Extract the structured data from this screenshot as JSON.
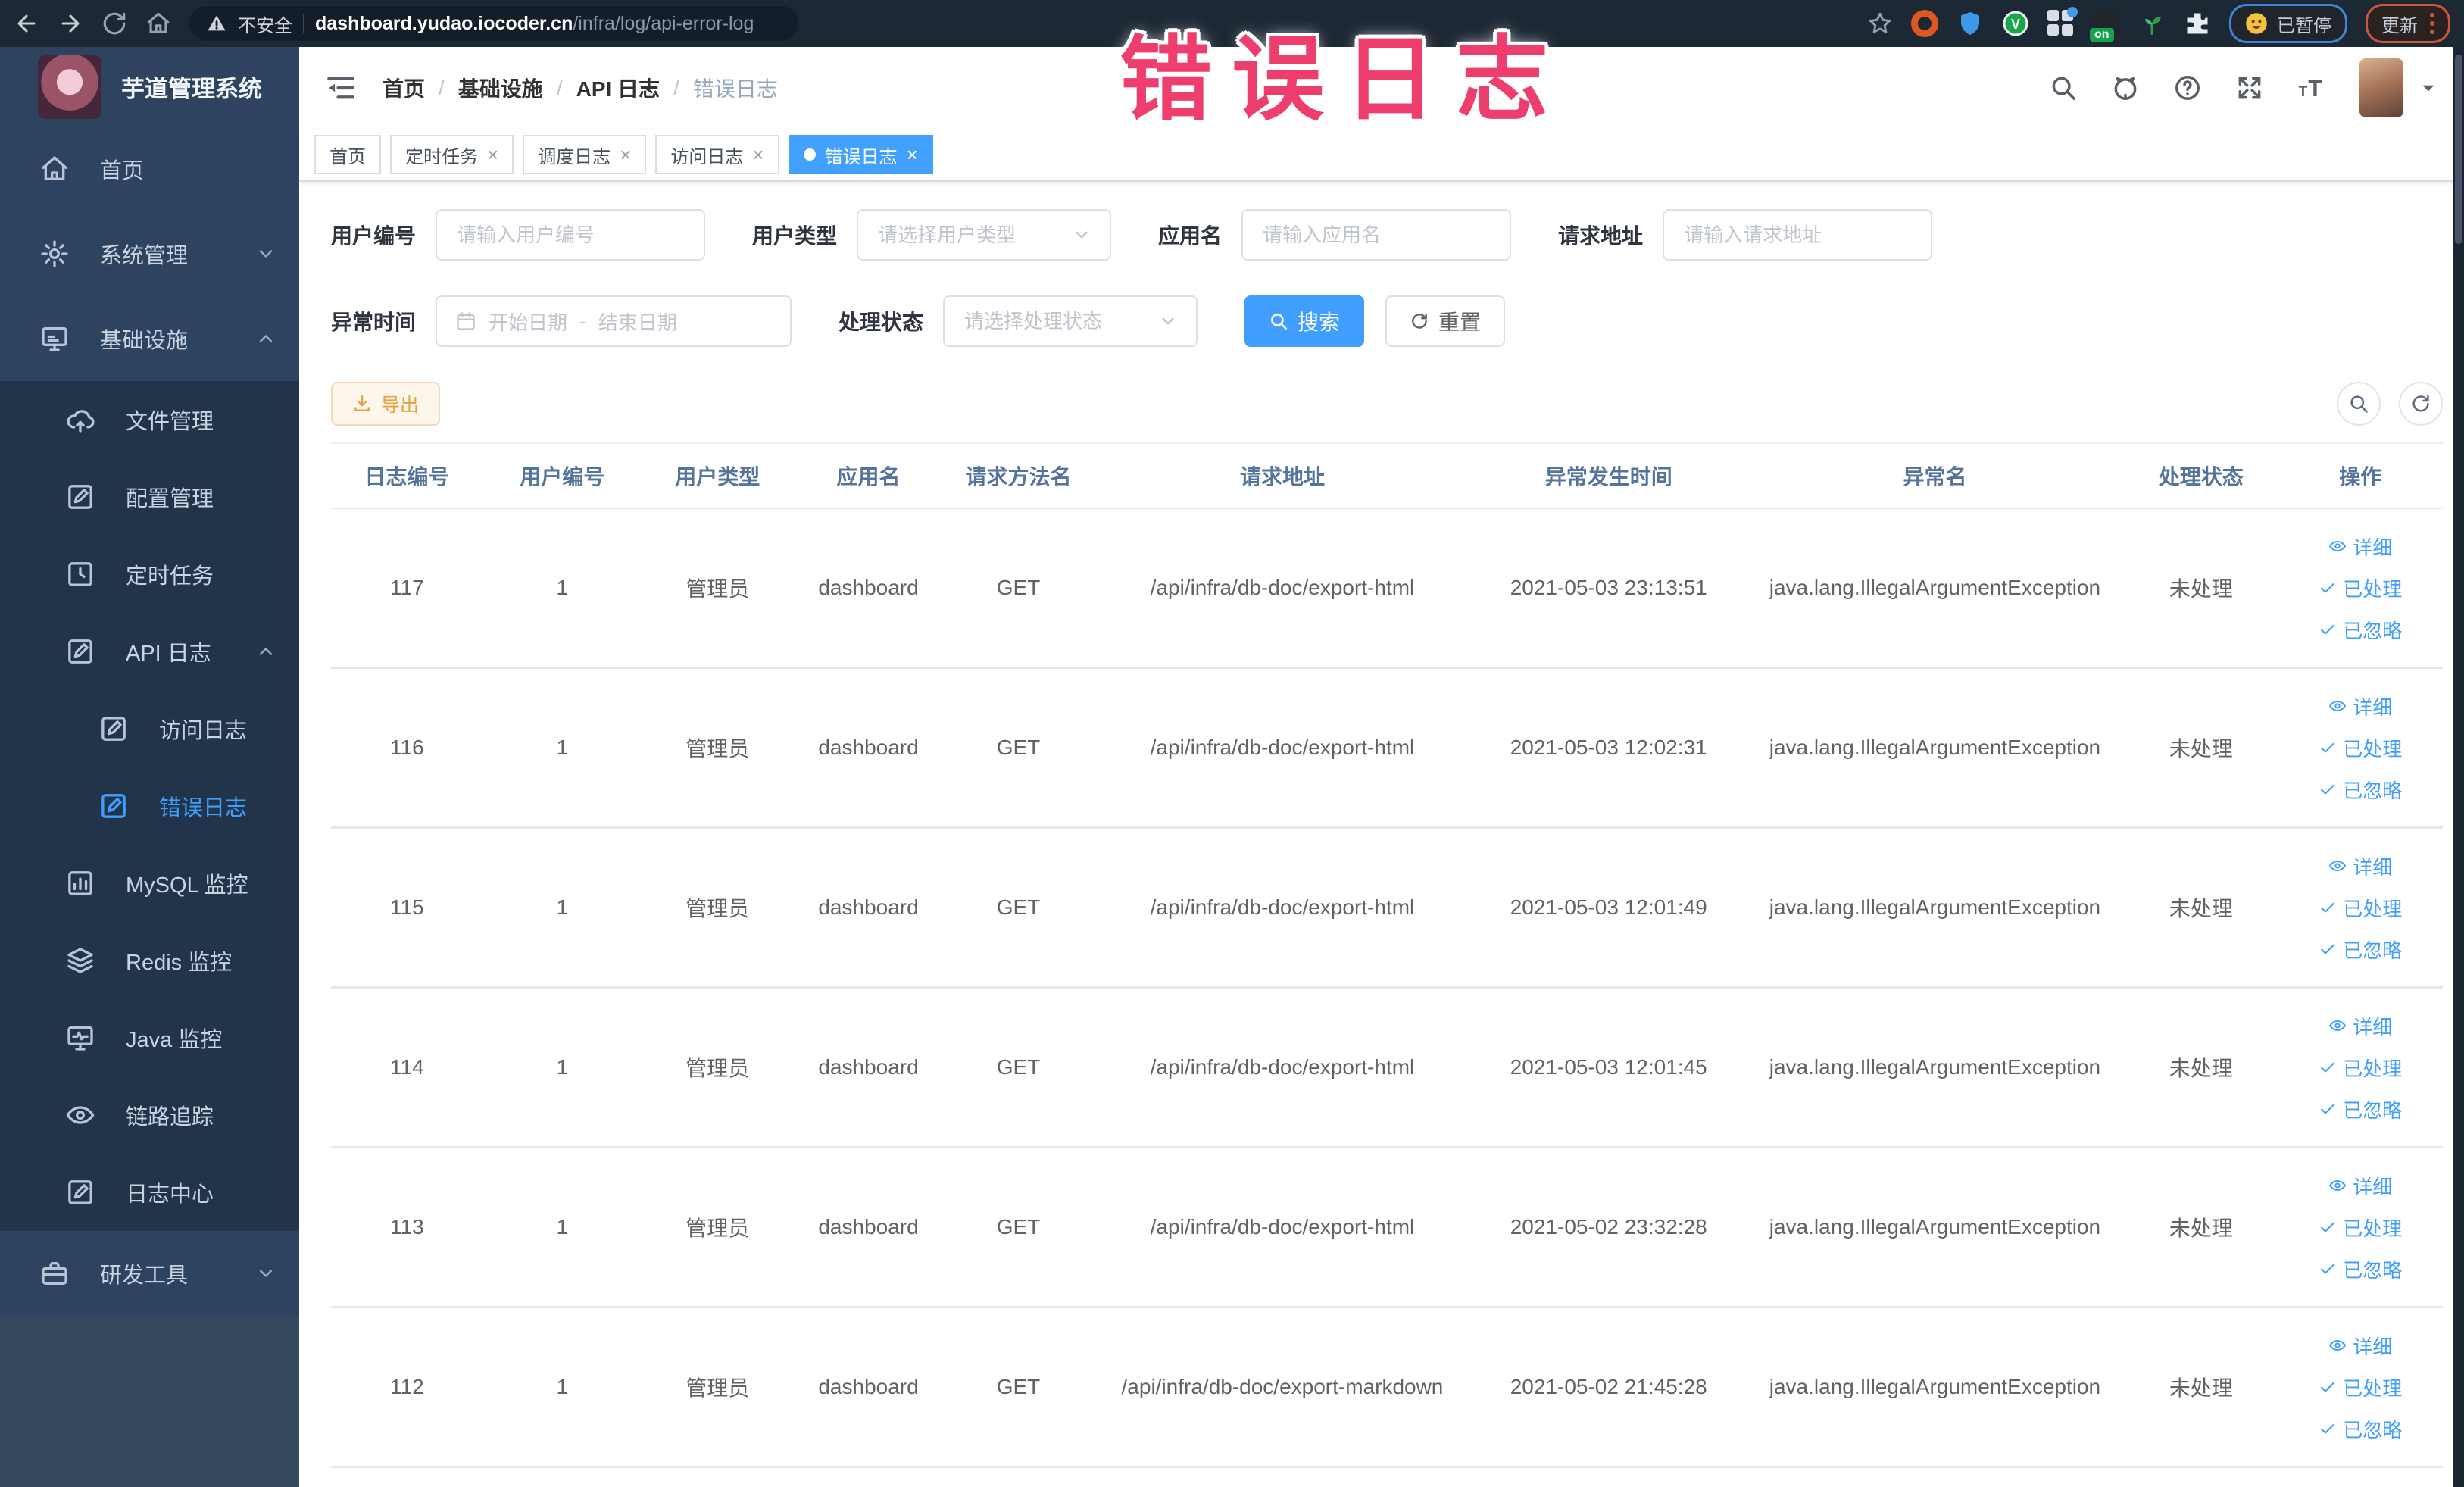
{
  "browser": {
    "security_label": "不安全",
    "url_domain": "dashboard.yudao.iocoder.cn",
    "url_path": "/infra/log/api-error-log",
    "paused_badge": "已暂停",
    "update_badge": "更新"
  },
  "overlay": {
    "title": "错误日志",
    "color": "#ee3e6d"
  },
  "sidebar": {
    "logo_title": "芋道管理系统",
    "items": [
      {
        "name": "home",
        "label": "首页",
        "icon": "home",
        "level": 1,
        "sub": false
      },
      {
        "name": "system-management",
        "label": "系统管理",
        "icon": "gear",
        "level": 1,
        "sub": false,
        "arrow": "down"
      },
      {
        "name": "infrastructure",
        "label": "基础设施",
        "icon": "infra",
        "level": 1,
        "sub": false,
        "arrow": "up"
      },
      {
        "name": "file-management",
        "label": "文件管理",
        "icon": "cloud",
        "level": 2,
        "sub": true
      },
      {
        "name": "config-management",
        "label": "配置管理",
        "icon": "edit",
        "level": 2,
        "sub": true
      },
      {
        "name": "scheduled-jobs",
        "label": "定时任务",
        "icon": "job",
        "level": 2,
        "sub": true
      },
      {
        "name": "api-log",
        "label": "API 日志",
        "icon": "edit",
        "level": 2,
        "sub": true,
        "arrow": "up"
      },
      {
        "name": "access-log",
        "label": "访问日志",
        "icon": "edit",
        "level": 3,
        "sub": true
      },
      {
        "name": "error-log",
        "label": "错误日志",
        "icon": "edit",
        "level": 3,
        "sub": true,
        "active": true
      },
      {
        "name": "mysql-monitor",
        "label": "MySQL 监控",
        "icon": "chart",
        "level": 2,
        "sub": true
      },
      {
        "name": "redis-monitor",
        "label": "Redis 监控",
        "icon": "layers",
        "level": 2,
        "sub": true
      },
      {
        "name": "java-monitor",
        "label": "Java 监控",
        "icon": "monitor",
        "level": 2,
        "sub": true
      },
      {
        "name": "trace",
        "label": "链路追踪",
        "icon": "eye",
        "level": 2,
        "sub": true
      },
      {
        "name": "log-center",
        "label": "日志中心",
        "icon": "edit",
        "level": 2,
        "sub": true
      },
      {
        "name": "dev-tools",
        "label": "研发工具",
        "icon": "tools",
        "level": 1,
        "sub": false,
        "arrow": "down"
      }
    ]
  },
  "breadcrumb": {
    "items": [
      "首页",
      "基础设施",
      "API 日志",
      "错误日志"
    ]
  },
  "tabs": [
    {
      "name": "home",
      "label": "首页",
      "closable": false,
      "active": false
    },
    {
      "name": "scheduled-jobs",
      "label": "定时任务",
      "closable": true,
      "active": false
    },
    {
      "name": "schedule-log",
      "label": "调度日志",
      "closable": true,
      "active": false
    },
    {
      "name": "access-log",
      "label": "访问日志",
      "closable": true,
      "active": false
    },
    {
      "name": "error-log",
      "label": "错误日志",
      "closable": true,
      "active": true
    }
  ],
  "filters": {
    "user_id": {
      "label": "用户编号",
      "placeholder": "请输入用户编号"
    },
    "user_type": {
      "label": "用户类型",
      "placeholder": "请选择用户类型"
    },
    "app_name": {
      "label": "应用名",
      "placeholder": "请输入应用名"
    },
    "request_url": {
      "label": "请求地址",
      "placeholder": "请输入请求地址"
    },
    "exception_time": {
      "label": "异常时间",
      "start_placeholder": "开始日期",
      "separator": "-",
      "end_placeholder": "结束日期"
    },
    "process_status": {
      "label": "处理状态",
      "placeholder": "请选择处理状态"
    },
    "search_label": "搜索",
    "reset_label": "重置"
  },
  "toolbar": {
    "export_label": "导出"
  },
  "table": {
    "columns": [
      "日志编号",
      "用户编号",
      "用户类型",
      "应用名",
      "请求方法名",
      "请求地址",
      "异常发生时间",
      "异常名",
      "处理状态",
      "操作"
    ],
    "actions": {
      "detail": "详细",
      "processed": "已处理",
      "ignored": "已忽略"
    },
    "rows": [
      {
        "id": "117",
        "user_id": "1",
        "user_type": "管理员",
        "app": "dashboard",
        "method": "GET",
        "url": "/api/infra/db-doc/export-html",
        "time": "2021-05-03 23:13:51",
        "exception": "java.lang.IllegalArgumentException",
        "status": "未处理"
      },
      {
        "id": "116",
        "user_id": "1",
        "user_type": "管理员",
        "app": "dashboard",
        "method": "GET",
        "url": "/api/infra/db-doc/export-html",
        "time": "2021-05-03 12:02:31",
        "exception": "java.lang.IllegalArgumentException",
        "status": "未处理"
      },
      {
        "id": "115",
        "user_id": "1",
        "user_type": "管理员",
        "app": "dashboard",
        "method": "GET",
        "url": "/api/infra/db-doc/export-html",
        "time": "2021-05-03 12:01:49",
        "exception": "java.lang.IllegalArgumentException",
        "status": "未处理"
      },
      {
        "id": "114",
        "user_id": "1",
        "user_type": "管理员",
        "app": "dashboard",
        "method": "GET",
        "url": "/api/infra/db-doc/export-html",
        "time": "2021-05-03 12:01:45",
        "exception": "java.lang.IllegalArgumentException",
        "status": "未处理"
      },
      {
        "id": "113",
        "user_id": "1",
        "user_type": "管理员",
        "app": "dashboard",
        "method": "GET",
        "url": "/api/infra/db-doc/export-html",
        "time": "2021-05-02 23:32:28",
        "exception": "java.lang.IllegalArgumentException",
        "status": "未处理"
      },
      {
        "id": "112",
        "user_id": "1",
        "user_type": "管理员",
        "app": "dashboard",
        "method": "GET",
        "url": "/api/infra/db-doc/export-markdown",
        "time": "2021-05-02 21:45:28",
        "exception": "java.lang.IllegalArgumentException",
        "status": "未处理"
      }
    ]
  }
}
